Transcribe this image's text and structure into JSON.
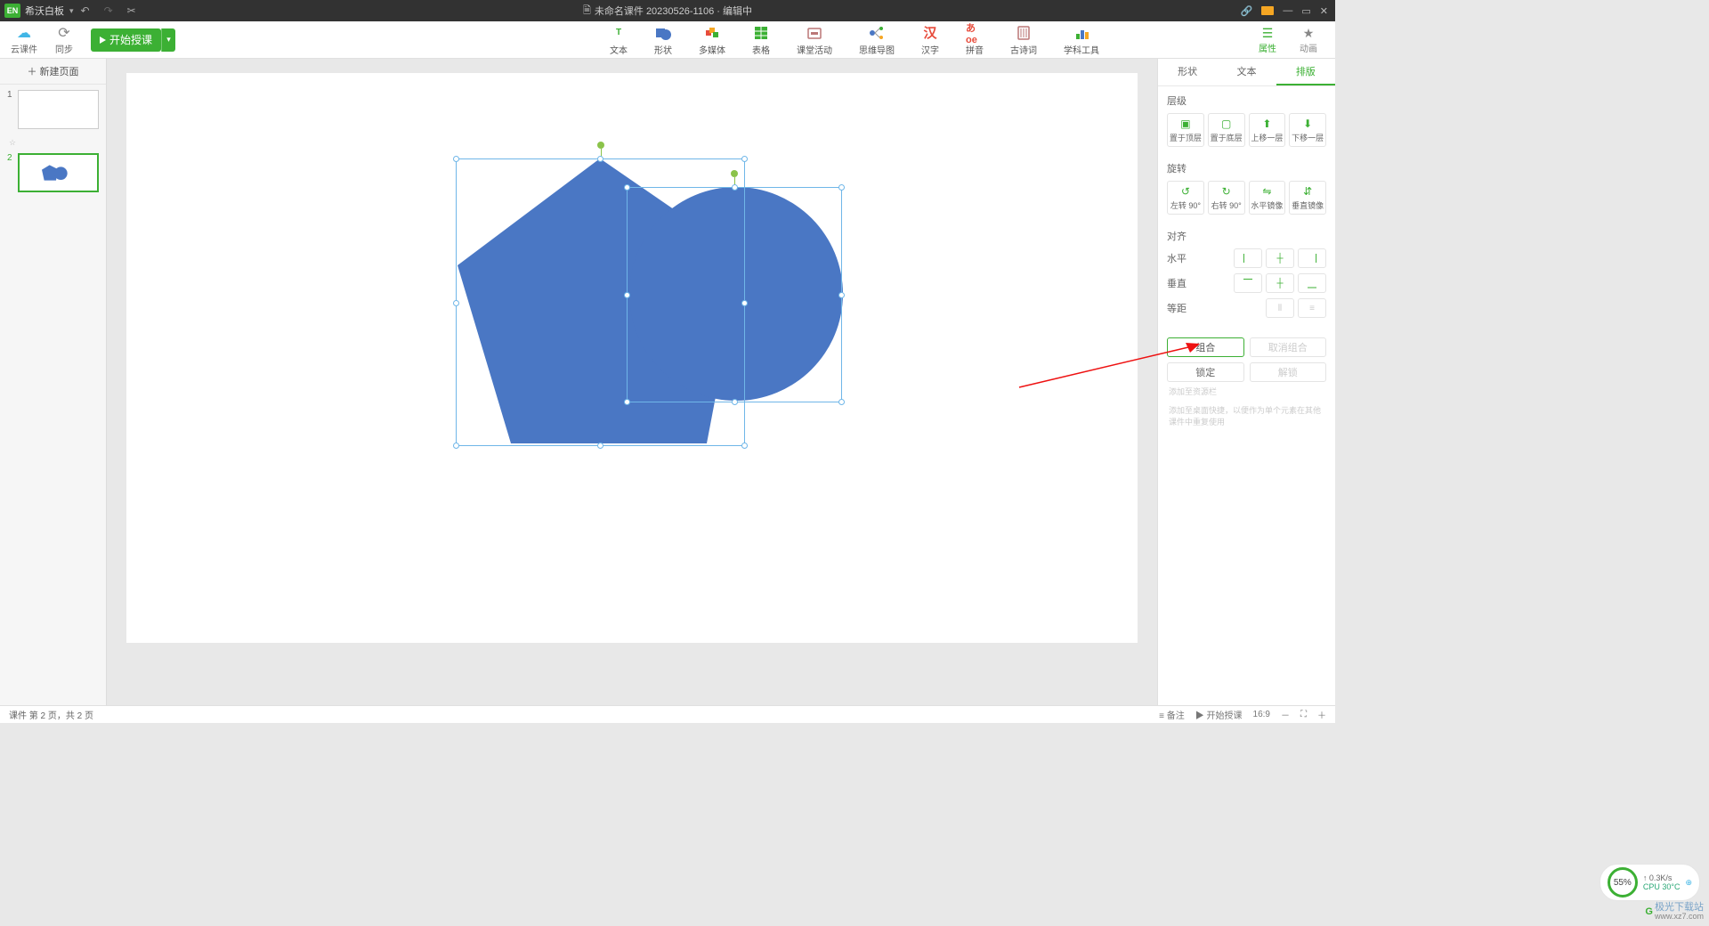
{
  "titlebar": {
    "app_name": "希沃白板",
    "doc_prefix": "📄",
    "doc_name": "未命名课件 20230526-1106 · 编辑中"
  },
  "toprow": {
    "cloud1": "云课件",
    "cloud2": "同步",
    "start_class": "开始授课",
    "tools": [
      "文本",
      "形状",
      "多媒体",
      "表格",
      "课堂活动",
      "思维导图",
      "汉字",
      "拼音",
      "古诗词",
      "学科工具"
    ],
    "attr": "属性",
    "anim": "动画"
  },
  "left": {
    "new_page": "＋ 新建页面",
    "slides": [
      "1",
      "2"
    ]
  },
  "rp": {
    "tabs": [
      "形状",
      "文本",
      "排版"
    ],
    "layer": "层级",
    "layer_btns": [
      "置于顶层",
      "置于底层",
      "上移一层",
      "下移一层"
    ],
    "rotate": "旋转",
    "rotate_btns": [
      "左转 90°",
      "右转 90°",
      "水平镜像",
      "垂直镜像"
    ],
    "align": "对齐",
    "horiz": "水平",
    "vert": "垂直",
    "equal": "等距",
    "group": "组合",
    "ungroup": "取消组合",
    "lock": "锁定",
    "unlock": "解锁",
    "hint1": "添加至资源栏",
    "hint2": "添加至桌面快捷，以便作为单个元素在其他课件中重复使用"
  },
  "status": {
    "pages": "课件 第 2 页，共 2 页",
    "note": "≡ 备注",
    "start": "▶ 开始授课",
    "ratio": "16:9",
    "zoom_out": "－",
    "zoom_in": "＋",
    "fit": "⛶"
  },
  "perf": {
    "pct": "55%",
    "net": "↑ 0.3K/s",
    "cpu": "CPU 30°C"
  },
  "watermark": {
    "text": "极光下载站",
    "url": "www.xz7.com"
  }
}
